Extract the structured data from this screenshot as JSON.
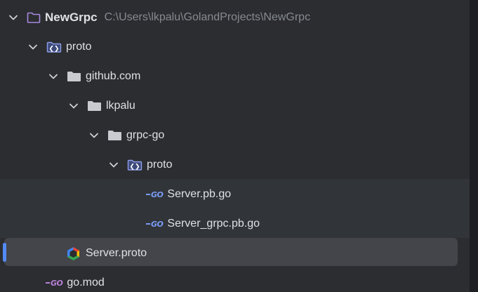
{
  "project": {
    "name": "NewGrpc",
    "path": "C:\\Users\\lkpalu\\GolandProjects\\NewGrpc"
  },
  "nodes": {
    "proto_root": "proto",
    "github": "github.com",
    "user": "lkpalu",
    "grpc_go": "grpc-go",
    "proto_inner": "proto",
    "server_pb": "Server.pb.go",
    "server_grpc_pb": "Server_grpc.pb.go",
    "server_proto": "Server.proto",
    "go_mod": "go.mod"
  },
  "icons": {
    "go_file_badge": "GO",
    "colors": {
      "go_blue": "#7a9cf5",
      "go_purple": "#b77fd6",
      "folder": "#c9cbd0",
      "proto_folder": "#8f9fe8",
      "project_folder": "#a98ae0",
      "selection_accent": "#548af7"
    }
  }
}
